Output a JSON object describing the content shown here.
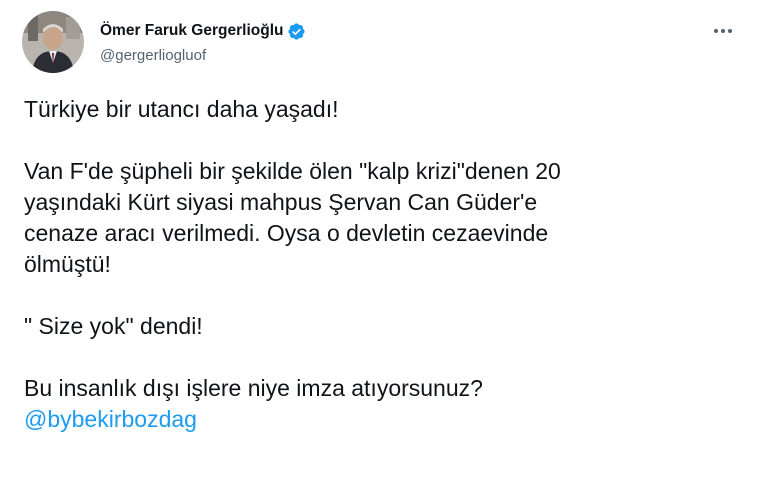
{
  "author": {
    "display_name": "Ömer Faruk Gergerlioğlu",
    "handle": "@gergerliogluof",
    "verified": true,
    "verified_color": "#1d9bf0"
  },
  "menu": {
    "icon": "more-horizontal-icon"
  },
  "tweet": {
    "line1": "Türkiye bir utancı daha yaşadı!",
    "line2": "Van F'de şüpheli bir şekilde ölen \"kalp krizi\"denen 20",
    "line3": "yaşındaki Kürt siyasi mahpus Şervan Can Güder'e",
    "line4": "cenaze aracı verilmedi. Oysa o devletin cezaevinde",
    "line5": "ölmüştü!",
    "line6": "\" Size yok\" dendi!",
    "line7": "Bu insanlık dışı işlere niye imza atıyorsunuz?",
    "mention": "@bybekirbozdag"
  },
  "colors": {
    "text": "#0f1419",
    "secondary": "#536471",
    "link": "#1d9bf0"
  }
}
